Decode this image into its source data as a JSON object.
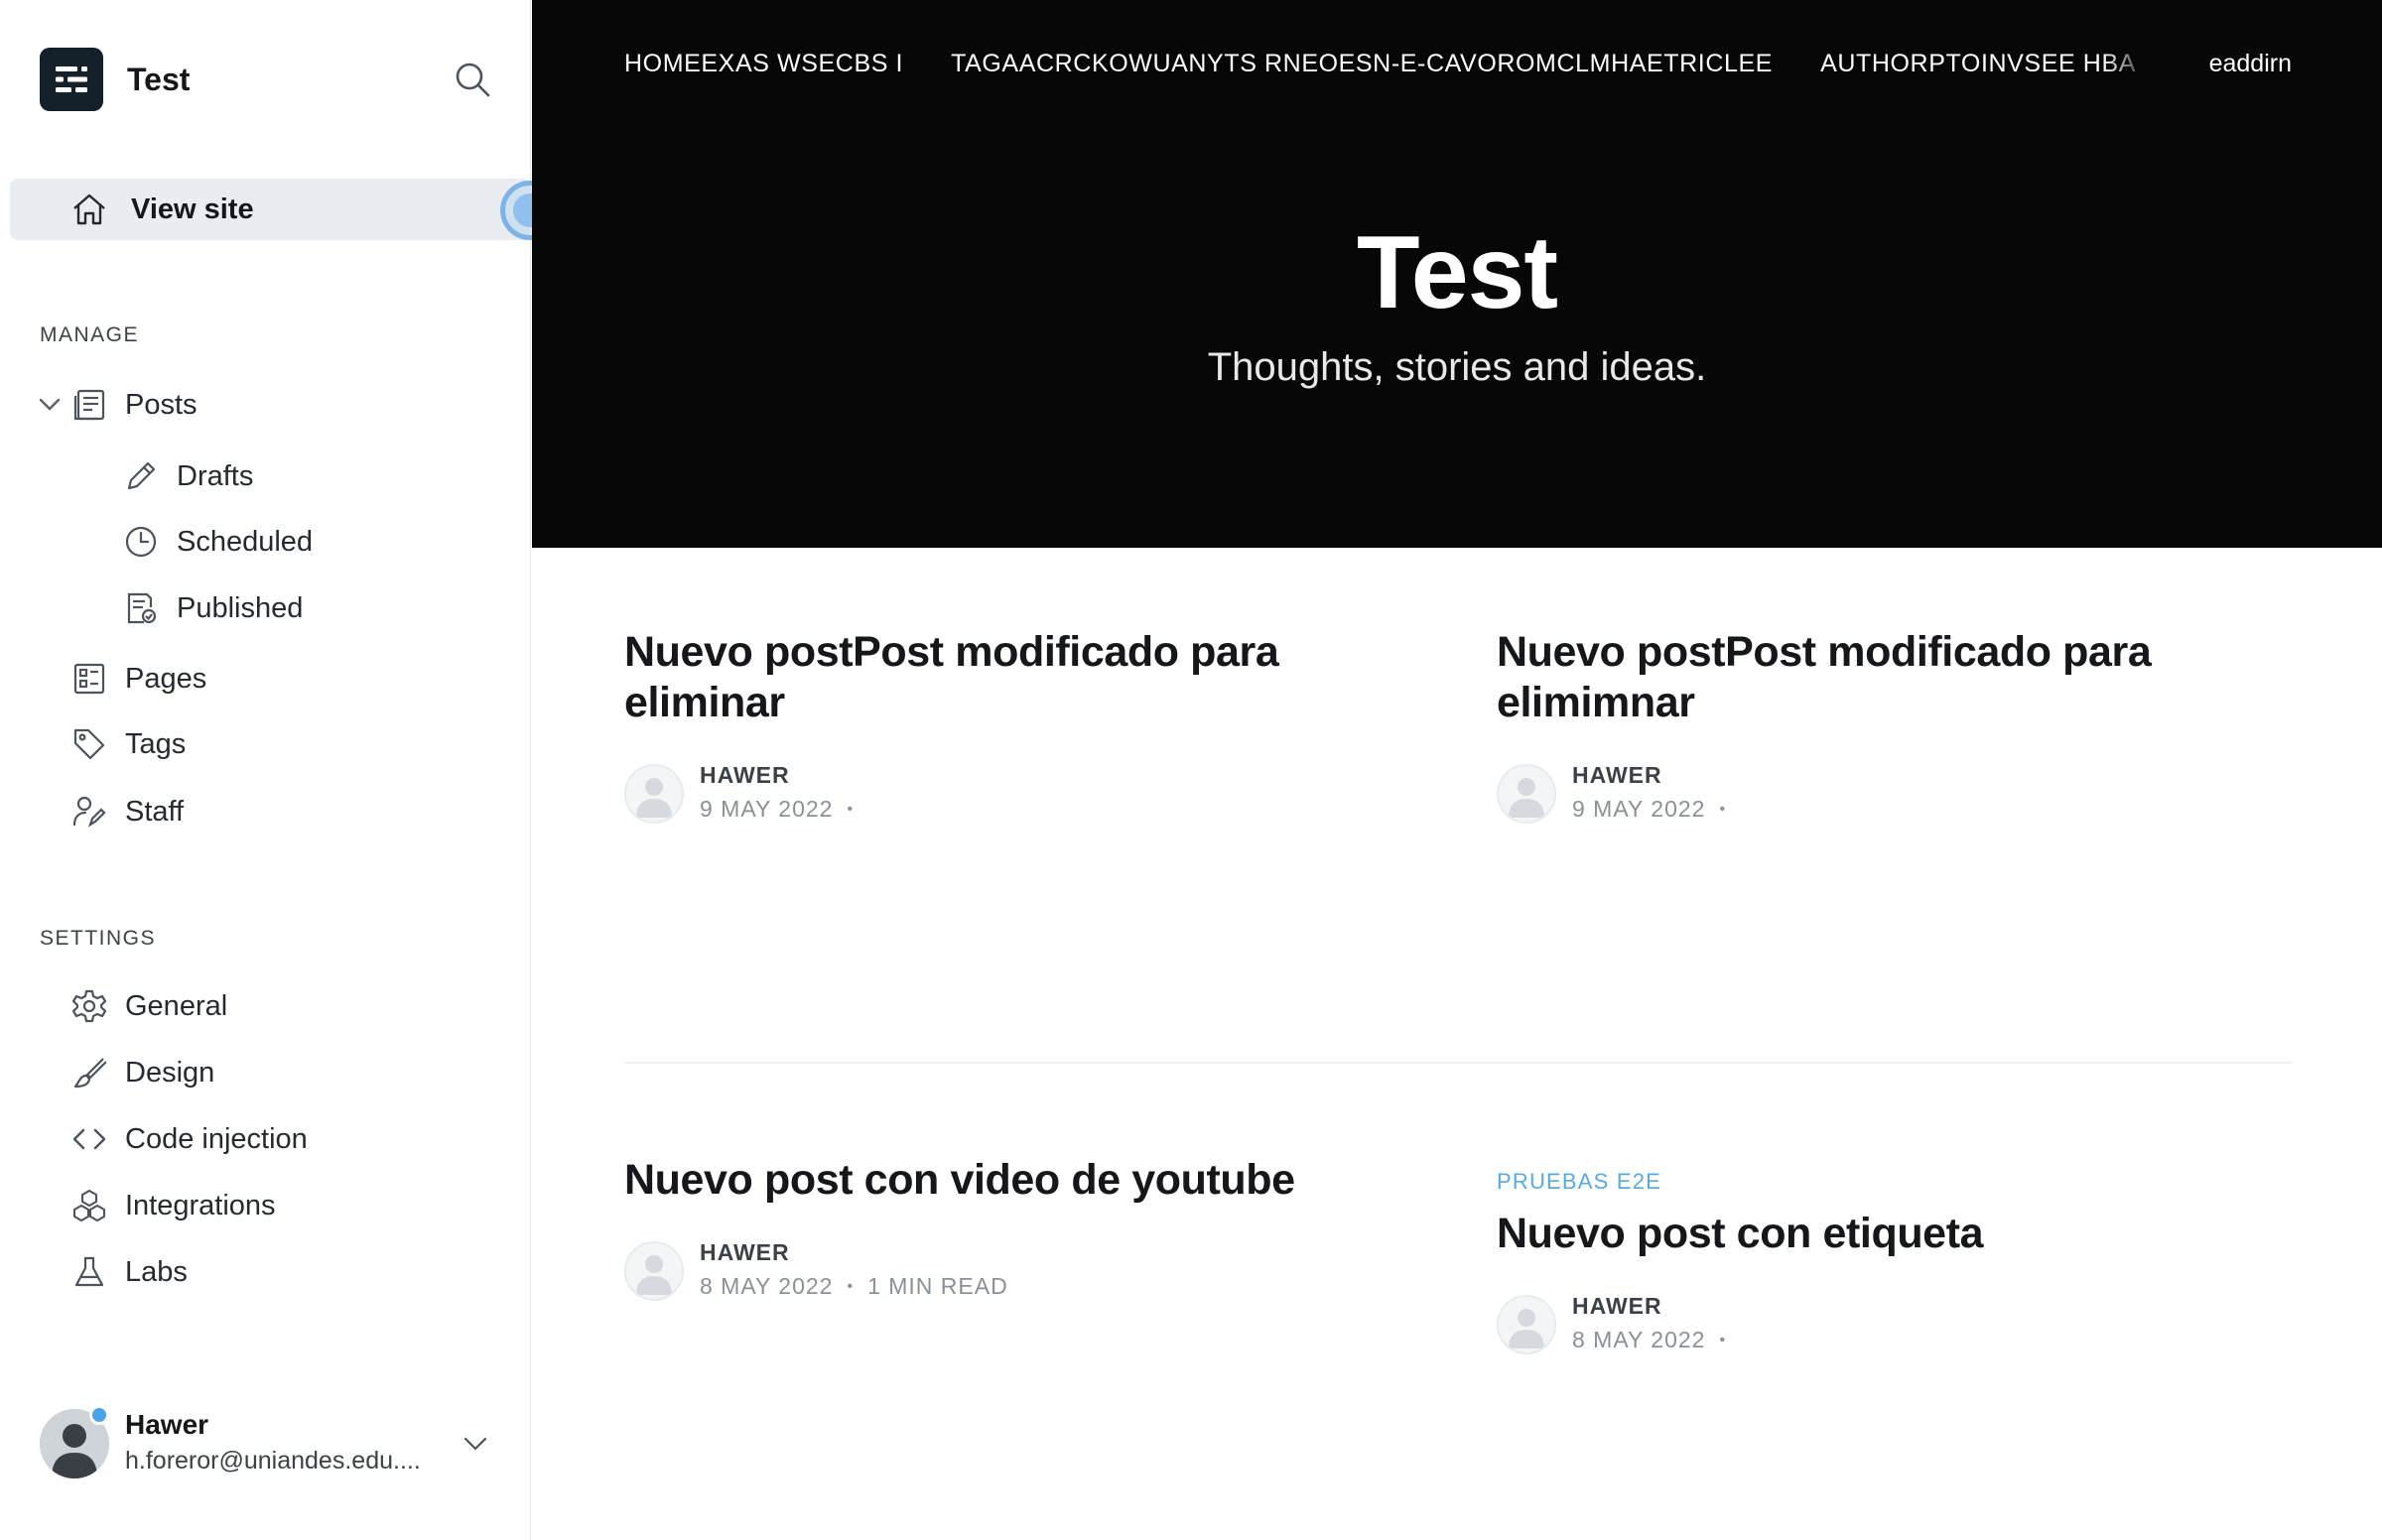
{
  "sidebar": {
    "brand_title": "Test",
    "view_site": "View site",
    "manage_label": "MANAGE",
    "posts": "Posts",
    "drafts": "Drafts",
    "scheduled": "Scheduled",
    "published": "Published",
    "pages": "Pages",
    "tags": "Tags",
    "staff": "Staff",
    "settings_label": "SETTINGS",
    "general": "General",
    "design": "Design",
    "code_injection": "Code injection",
    "integrations": "Integrations",
    "labs": "Labs",
    "user": {
      "name": "Hawer",
      "email": "h.foreror@uniandes.edu...."
    }
  },
  "site": {
    "nav_items": [
      "HOMEEXAS WSECBS I",
      "TAGAACRCKOWUANYTS RNEOESN-E-CAVOROMCLMHAETRICLEE",
      "AUTHORPTOINVSEE HBA"
    ],
    "account_link": "eaddirn",
    "title": "Test",
    "description": "Thoughts, stories and ideas."
  },
  "posts": [
    {
      "tag": "",
      "title": "Nuevo postPost modificado para eliminar",
      "author": "HAWER",
      "date": "9 MAY 2022",
      "separator": "•",
      "reading_time": ""
    },
    {
      "tag": "",
      "title": "Nuevo postPost modificado para elimimnar",
      "author": "HAWER",
      "date": "9 MAY 2022",
      "separator": "•",
      "reading_time": ""
    },
    {
      "tag": "",
      "title": "Nuevo post con video de youtube",
      "author": "HAWER",
      "date": "8 MAY 2022",
      "separator": "•",
      "reading_time": "1 MIN READ"
    },
    {
      "tag": "PRUEBAS E2E",
      "title": "Nuevo post con etiqueta",
      "author": "HAWER",
      "date": "8 MAY 2022",
      "separator": "•",
      "reading_time": ""
    }
  ],
  "colors": {
    "hero_bg": "#070708",
    "tag_accent": "#5aa9e0",
    "active_nav_bg": "#e9edf1",
    "status_dot": "#4aa3e8"
  }
}
